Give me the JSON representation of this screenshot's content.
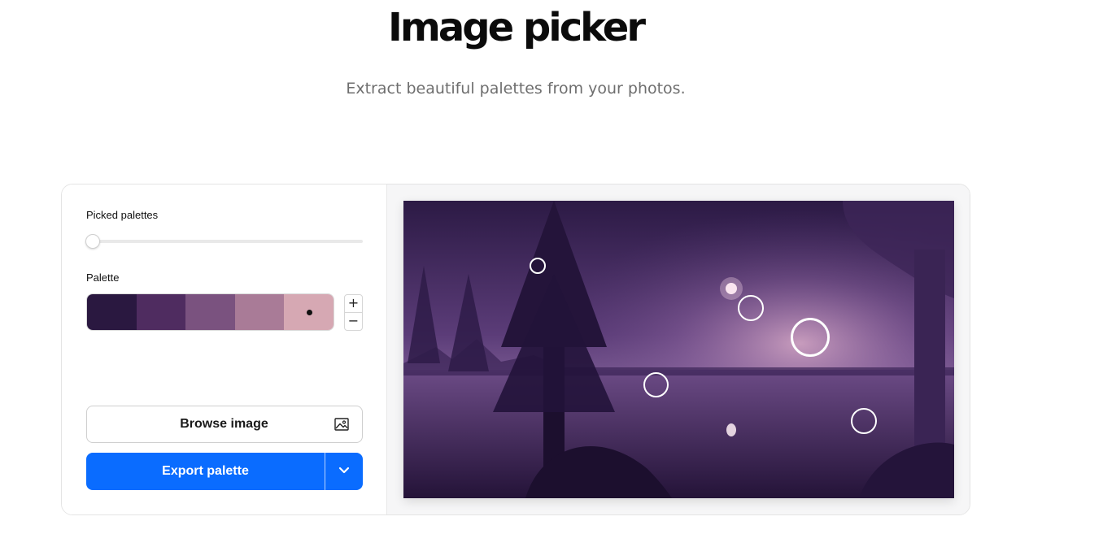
{
  "header": {
    "title": "Image picker",
    "subtitle": "Extract beautiful palettes from your photos."
  },
  "controls": {
    "picked_palettes_label": "Picked palettes",
    "picked_palettes_value": 0,
    "palette_label": "Palette",
    "stepper_plus": "+",
    "stepper_minus": "−"
  },
  "palette": {
    "colors": [
      "#2a1840",
      "#4f2c60",
      "#7a527f",
      "#a97b97",
      "#d6a8b3"
    ],
    "selected_index": 4
  },
  "buttons": {
    "browse_label": "Browse image",
    "export_label": "Export palette"
  },
  "icons": {
    "browse": "image-icon",
    "export_menu": "chevron-down-icon"
  },
  "colors": {
    "accent": "#0a6cff"
  },
  "image": {
    "description_color_sky": "#3a2457",
    "description_color_glow": "#c89ab4"
  }
}
